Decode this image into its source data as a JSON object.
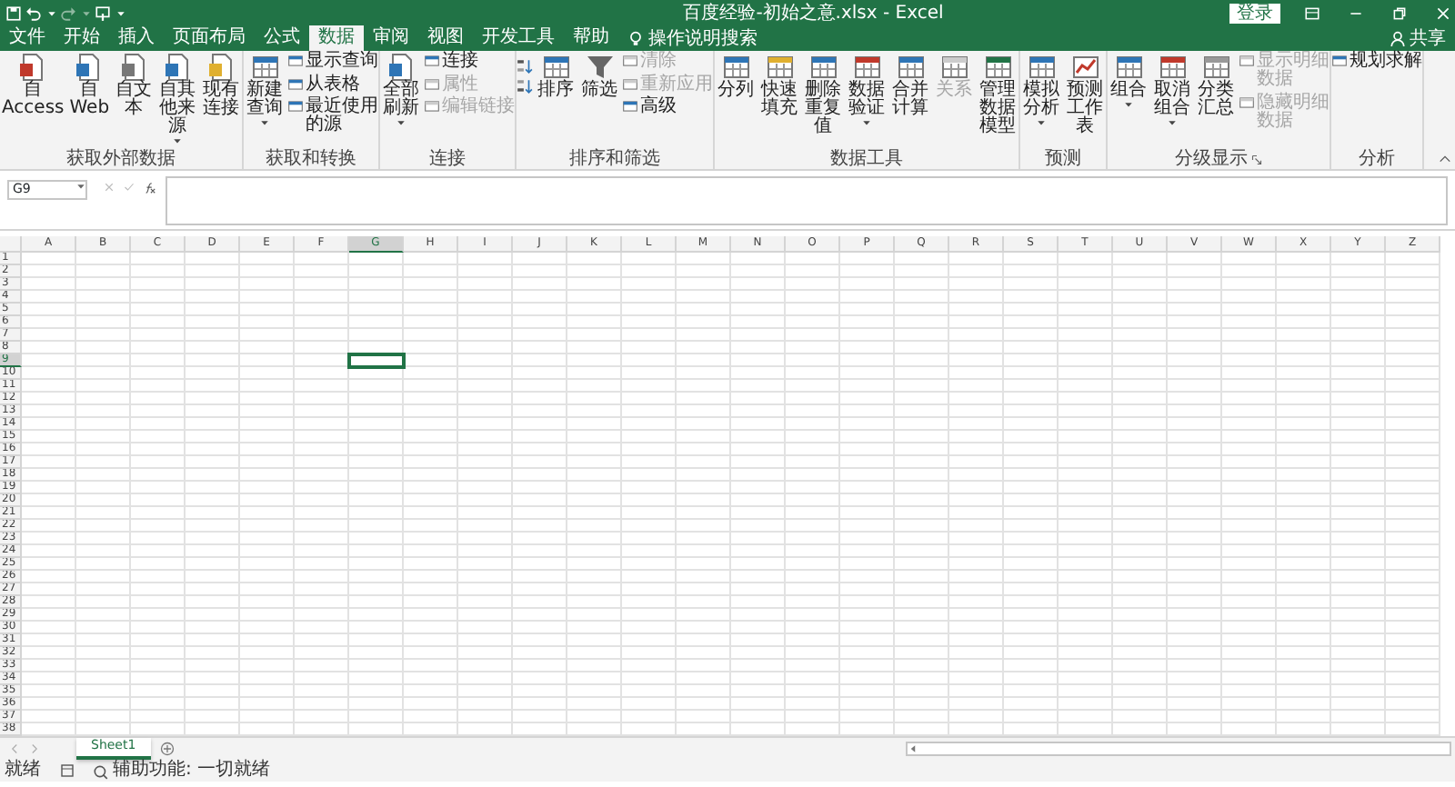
{
  "window": {
    "title": "百度经验-初始之意.xlsx  -  Excel",
    "sign_in": "登录",
    "share": "共享"
  },
  "ribbon_tabs": [
    {
      "label": "文件",
      "selected": false
    },
    {
      "label": "开始",
      "selected": false
    },
    {
      "label": "插入",
      "selected": false
    },
    {
      "label": "页面布局",
      "selected": false
    },
    {
      "label": "公式",
      "selected": false
    },
    {
      "label": "数据",
      "selected": true
    },
    {
      "label": "审阅",
      "selected": false
    },
    {
      "label": "视图",
      "selected": false
    },
    {
      "label": "开发工具",
      "selected": false
    },
    {
      "label": "帮助",
      "selected": false
    }
  ],
  "tell_me": "操作说明搜索",
  "ribbon_groups": [
    {
      "label": "获取外部数据",
      "launcher": false,
      "items": [
        {
          "kind": "large",
          "label": "自 Access",
          "dropdown": false,
          "disabled": false
        },
        {
          "kind": "large",
          "label": "自 Web",
          "dropdown": false,
          "disabled": false
        },
        {
          "kind": "large",
          "label": "自文本",
          "dropdown": false,
          "disabled": false
        },
        {
          "kind": "large",
          "label": "自其他来源",
          "dropdown": true,
          "disabled": false
        },
        {
          "kind": "large",
          "label": "现有连接",
          "dropdown": false,
          "disabled": false
        }
      ]
    },
    {
      "label": "获取和转换",
      "launcher": false,
      "items": [
        {
          "kind": "large",
          "label": "新建查询",
          "dropdown": true,
          "disabled": false
        },
        {
          "kind": "small_column",
          "entries": [
            {
              "label": "显示查询",
              "disabled": false
            },
            {
              "label": "从表格",
              "disabled": false
            },
            {
              "label": "最近使用的源",
              "disabled": false
            }
          ]
        }
      ]
    },
    {
      "label": "连接",
      "launcher": false,
      "items": [
        {
          "kind": "large",
          "label": "全部刷新",
          "dropdown": true,
          "disabled": false
        },
        {
          "kind": "small_column",
          "entries": [
            {
              "label": "连接",
              "disabled": false
            },
            {
              "label": "属性",
              "disabled": true
            },
            {
              "label": "编辑链接",
              "disabled": true
            }
          ]
        }
      ]
    },
    {
      "label": "排序和筛选",
      "launcher": false,
      "items": [
        {
          "kind": "sort_icons"
        },
        {
          "kind": "large",
          "label": "排序",
          "dropdown": false,
          "disabled": false
        },
        {
          "kind": "large",
          "label": "筛选",
          "dropdown": false,
          "disabled": false
        },
        {
          "kind": "small_column",
          "entries": [
            {
              "label": "清除",
              "disabled": true
            },
            {
              "label": "重新应用",
              "disabled": true
            },
            {
              "label": "高级",
              "disabled": false
            }
          ]
        }
      ]
    },
    {
      "label": "数据工具",
      "launcher": false,
      "items": [
        {
          "kind": "large",
          "label": "分列",
          "dropdown": false,
          "disabled": false
        },
        {
          "kind": "large",
          "label": "快速填充",
          "dropdown": false,
          "disabled": false
        },
        {
          "kind": "large",
          "label": "删除重复值",
          "dropdown": false,
          "disabled": false
        },
        {
          "kind": "large",
          "label": "数据验证",
          "dropdown": true,
          "disabled": false
        },
        {
          "kind": "large",
          "label": "合并计算",
          "dropdown": false,
          "disabled": false
        },
        {
          "kind": "large",
          "label": "关系",
          "dropdown": false,
          "disabled": true
        },
        {
          "kind": "large",
          "label": "管理数据模型",
          "dropdown": false,
          "disabled": false
        }
      ]
    },
    {
      "label": "预测",
      "launcher": false,
      "items": [
        {
          "kind": "large",
          "label": "模拟分析",
          "dropdown": true,
          "disabled": false
        },
        {
          "kind": "large",
          "label": "预测工作表",
          "dropdown": false,
          "disabled": false
        }
      ]
    },
    {
      "label": "分级显示",
      "launcher": true,
      "items": [
        {
          "kind": "large",
          "label": "组合",
          "dropdown": true,
          "disabled": false
        },
        {
          "kind": "large",
          "label": "取消组合",
          "dropdown": true,
          "disabled": false
        },
        {
          "kind": "large",
          "label": "分类汇总",
          "dropdown": false,
          "disabled": false
        },
        {
          "kind": "small_column",
          "entries": [
            {
              "label": "显示明细数据",
              "disabled": true
            },
            {
              "label": "隐藏明细数据",
              "disabled": true
            }
          ]
        }
      ]
    },
    {
      "label": "分析",
      "launcher": false,
      "items": [
        {
          "kind": "small_column",
          "entries": [
            {
              "label": "规划求解",
              "disabled": false
            }
          ]
        }
      ]
    }
  ],
  "name_box": "G9",
  "columns": [
    {
      "label": "A",
      "selected": false
    },
    {
      "label": "B",
      "selected": false
    },
    {
      "label": "C",
      "selected": false
    },
    {
      "label": "D",
      "selected": false
    },
    {
      "label": "E",
      "selected": false
    },
    {
      "label": "F",
      "selected": false
    },
    {
      "label": "G",
      "selected": true
    },
    {
      "label": "H",
      "selected": false
    },
    {
      "label": "I",
      "selected": false
    },
    {
      "label": "J",
      "selected": false
    },
    {
      "label": "K",
      "selected": false
    },
    {
      "label": "L",
      "selected": false
    },
    {
      "label": "M",
      "selected": false
    },
    {
      "label": "N",
      "selected": false
    },
    {
      "label": "O",
      "selected": false
    },
    {
      "label": "P",
      "selected": false
    },
    {
      "label": "Q",
      "selected": false
    },
    {
      "label": "R",
      "selected": false
    },
    {
      "label": "S",
      "selected": false
    },
    {
      "label": "T",
      "selected": false
    },
    {
      "label": "U",
      "selected": false
    },
    {
      "label": "V",
      "selected": false
    },
    {
      "label": "W",
      "selected": false
    },
    {
      "label": "X",
      "selected": false
    },
    {
      "label": "Y",
      "selected": false
    },
    {
      "label": "Z",
      "selected": false
    }
  ],
  "rows": [
    {
      "label": "1",
      "selected": false
    },
    {
      "label": "2",
      "selected": false
    },
    {
      "label": "3",
      "selected": false
    },
    {
      "label": "4",
      "selected": false
    },
    {
      "label": "5",
      "selected": false
    },
    {
      "label": "6",
      "selected": false
    },
    {
      "label": "7",
      "selected": false
    },
    {
      "label": "8",
      "selected": false
    },
    {
      "label": "9",
      "selected": true
    },
    {
      "label": "10",
      "selected": false
    },
    {
      "label": "11",
      "selected": false
    },
    {
      "label": "12",
      "selected": false
    },
    {
      "label": "13",
      "selected": false
    },
    {
      "label": "14",
      "selected": false
    },
    {
      "label": "15",
      "selected": false
    },
    {
      "label": "16",
      "selected": false
    },
    {
      "label": "17",
      "selected": false
    },
    {
      "label": "18",
      "selected": false
    },
    {
      "label": "19",
      "selected": false
    },
    {
      "label": "20",
      "selected": false
    },
    {
      "label": "21",
      "selected": false
    },
    {
      "label": "22",
      "selected": false
    },
    {
      "label": "23",
      "selected": false
    },
    {
      "label": "24",
      "selected": false
    },
    {
      "label": "25",
      "selected": false
    },
    {
      "label": "26",
      "selected": false
    },
    {
      "label": "27",
      "selected": false
    },
    {
      "label": "28",
      "selected": false
    },
    {
      "label": "29",
      "selected": false
    },
    {
      "label": "30",
      "selected": false
    },
    {
      "label": "31",
      "selected": false
    },
    {
      "label": "32",
      "selected": false
    },
    {
      "label": "33",
      "selected": false
    },
    {
      "label": "34",
      "selected": false
    },
    {
      "label": "35",
      "selected": false
    },
    {
      "label": "36",
      "selected": false
    },
    {
      "label": "37",
      "selected": false
    },
    {
      "label": "38",
      "selected": false
    }
  ],
  "sheet_tabs": [
    {
      "label": "Sheet1",
      "selected": true
    }
  ],
  "status_bar": {
    "mode": "就绪",
    "accessibility": "辅助功能: 一切就绪"
  }
}
